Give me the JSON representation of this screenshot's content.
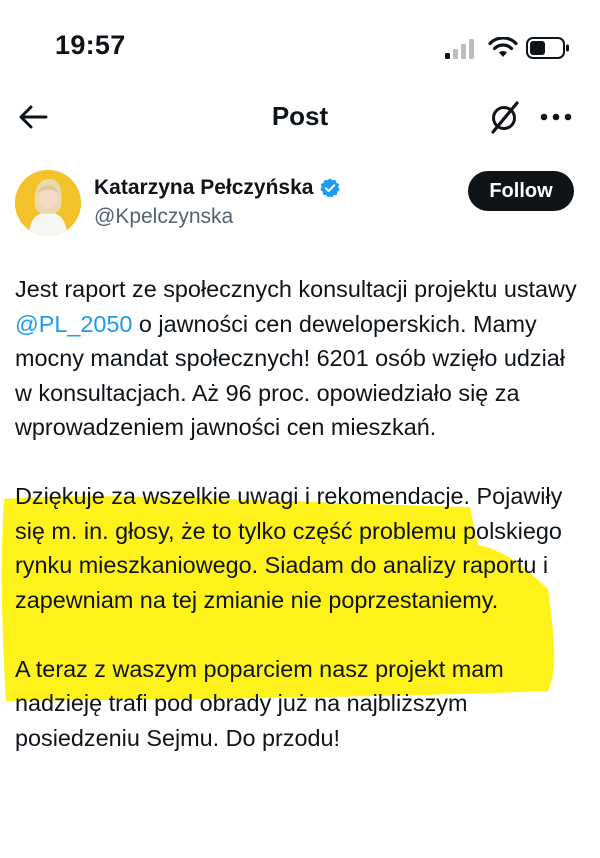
{
  "status_bar": {
    "time": "19:57",
    "icons": [
      "cellular-signal-icon",
      "wifi-icon",
      "battery-icon"
    ]
  },
  "nav": {
    "title": "Post",
    "back_icon": "arrow-left-icon",
    "grok_icon": "grok-icon",
    "more_icon": "more-horizontal-icon"
  },
  "author": {
    "name": "Katarzyna Pełczyńska",
    "handle": "@Kpelczynska",
    "verified_icon": "verified-badge-icon",
    "follow_label": "Follow"
  },
  "tweet": {
    "p1_before": "Jest raport ze społecznych konsultacji projektu ustawy ",
    "p1_mention": "@PL_2050",
    "p1_after": " o jawności cen deweloperskich. Mamy mocny mandat społecznych! 6201 osób wzięło udział w konsultacjach. Aż 96 proc. opowiedziało się za wprowadzeniem jawności cen mieszkań.",
    "p2": "Dziękuje za wszelkie uwagi i rekomendacje. Pojawiły się m. in. głosy, że to tylko część problemu polskiego rynku mieszkaniowego. Siadam do analizy raportu i zapewniam na tej zmianie nie poprzestaniemy.",
    "p3": "A teraz z waszym poparciem nasz projekt mam nadzieję trafi pod obrady już na najbliższym posiedzeniu Sejmu. Do przodu!"
  },
  "colors": {
    "accent": "#1d9bf0",
    "highlight": "#fff21a",
    "text": "#0f1419",
    "secondary_text": "#536471"
  }
}
